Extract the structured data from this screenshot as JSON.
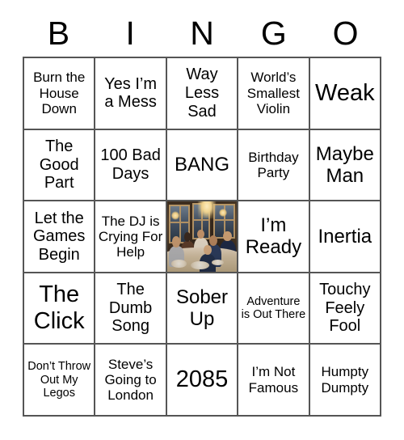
{
  "card": {
    "title": "BINGO",
    "header_letters": [
      "B",
      "I",
      "N",
      "G",
      "O"
    ],
    "columns": 5,
    "rows": 5,
    "grid_line_color": "#555555",
    "background_color": "#ffffff",
    "text_color": "#000000",
    "free_space": {
      "position": "row3-col3",
      "type": "image",
      "description": "photo of a group of people seated around a dinner table in a room with tall windows and a lit chandelier"
    },
    "cells": [
      [
        {
          "text": "Burn the House Down",
          "size": "md"
        },
        {
          "text": "Yes I’m a Mess",
          "size": "lg"
        },
        {
          "text": "Way Less Sad",
          "size": "lg"
        },
        {
          "text": "World’s Smallest Violin",
          "size": "md"
        },
        {
          "text": "Weak",
          "size": "xxl"
        }
      ],
      [
        {
          "text": "The Good Part",
          "size": "lg"
        },
        {
          "text": "100 Bad Days",
          "size": "lg"
        },
        {
          "text": "BANG",
          "size": "xl"
        },
        {
          "text": "Birthday Party",
          "size": "md"
        },
        {
          "text": "Maybe Man",
          "size": "xl"
        }
      ],
      [
        {
          "text": "Let the Games Begin",
          "size": "lg"
        },
        {
          "text": "The DJ is Crying For Help",
          "size": "md"
        },
        {
          "text": "",
          "size": "md",
          "image": true
        },
        {
          "text": "I’m Ready",
          "size": "xl"
        },
        {
          "text": "Inertia",
          "size": "xl"
        }
      ],
      [
        {
          "text": "The Click",
          "size": "xxl"
        },
        {
          "text": "The Dumb Song",
          "size": "lg"
        },
        {
          "text": "Sober Up",
          "size": "xl"
        },
        {
          "text": "Adventure is Out There",
          "size": "sm"
        },
        {
          "text": "Touchy Feely Fool",
          "size": "lg"
        }
      ],
      [
        {
          "text": "Don’t Throw Out My Legos",
          "size": "sm"
        },
        {
          "text": "Steve’s Going to London",
          "size": "md"
        },
        {
          "text": "2085",
          "size": "xxl"
        },
        {
          "text": "I’m Not Famous",
          "size": "md"
        },
        {
          "text": "Humpty Dumpty",
          "size": "md"
        }
      ]
    ]
  }
}
